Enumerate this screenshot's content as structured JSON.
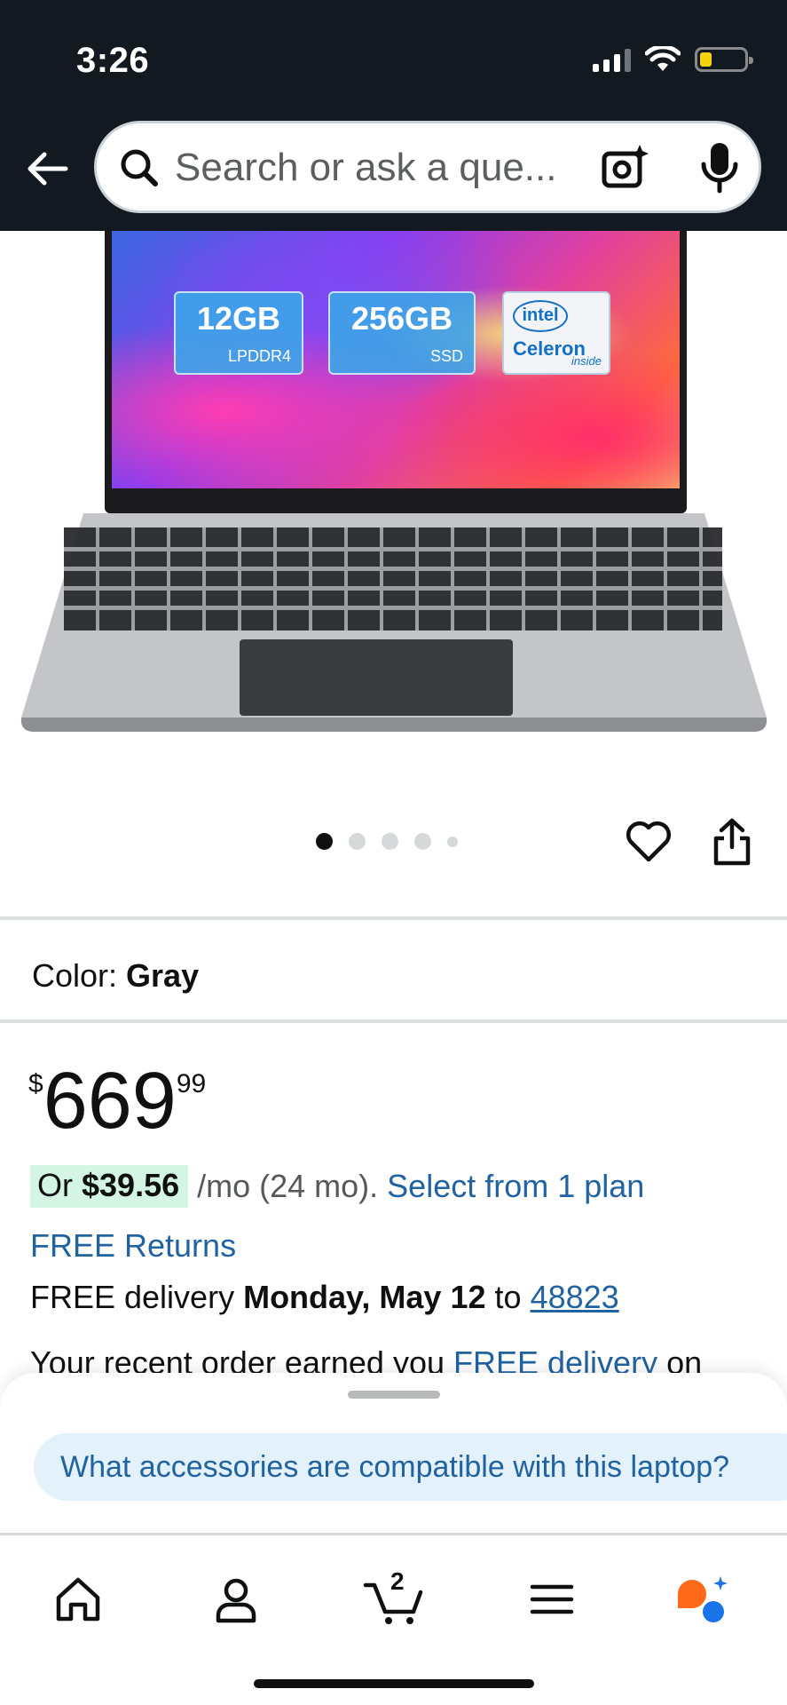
{
  "status_bar": {
    "time": "3:26"
  },
  "header": {
    "search": {
      "placeholder": "Search or ask a que..."
    }
  },
  "product_image": {
    "badges": {
      "ram_size": "12GB",
      "ram_type": "LPDDR4",
      "storage_size": "256GB",
      "storage_type": "SSD",
      "cpu_logo": "intel",
      "cpu_brand": "Celeron",
      "cpu_inside": "inside"
    },
    "carousel": {
      "count": 5,
      "active_index": 0
    }
  },
  "color": {
    "label": "Color:",
    "value": "Gray"
  },
  "price": {
    "symbol": "$",
    "whole": "669",
    "fraction": "99"
  },
  "financing": {
    "prefix": "Or",
    "monthly": "$39.56",
    "term": "/mo (24 mo).",
    "link": "Select from 1 plan"
  },
  "returns": {
    "label": "FREE Returns"
  },
  "delivery": {
    "prefix": "FREE delivery",
    "date": "Monday, May 12",
    "to": "to",
    "zip": "48823"
  },
  "recent_order": {
    "text": "Your recent order earned you",
    "link": "FREE delivery",
    "suffix": "on"
  },
  "bottom_sheet": {
    "suggestion": "What accessories are compatible with this laptop?"
  },
  "tabbar": {
    "cart_count": "2",
    "items": [
      "home-icon",
      "account-icon",
      "cart-icon",
      "menu-icon",
      "rufus-assistant-icon"
    ]
  },
  "colors": {
    "header_bg": "#131921",
    "link": "#2162a1",
    "financing_highlight": "#d4f5e4",
    "suggestion_bg": "#e3f1fb",
    "assistant_orange": "#ff6a1a",
    "assistant_blue": "#1a73e8"
  }
}
